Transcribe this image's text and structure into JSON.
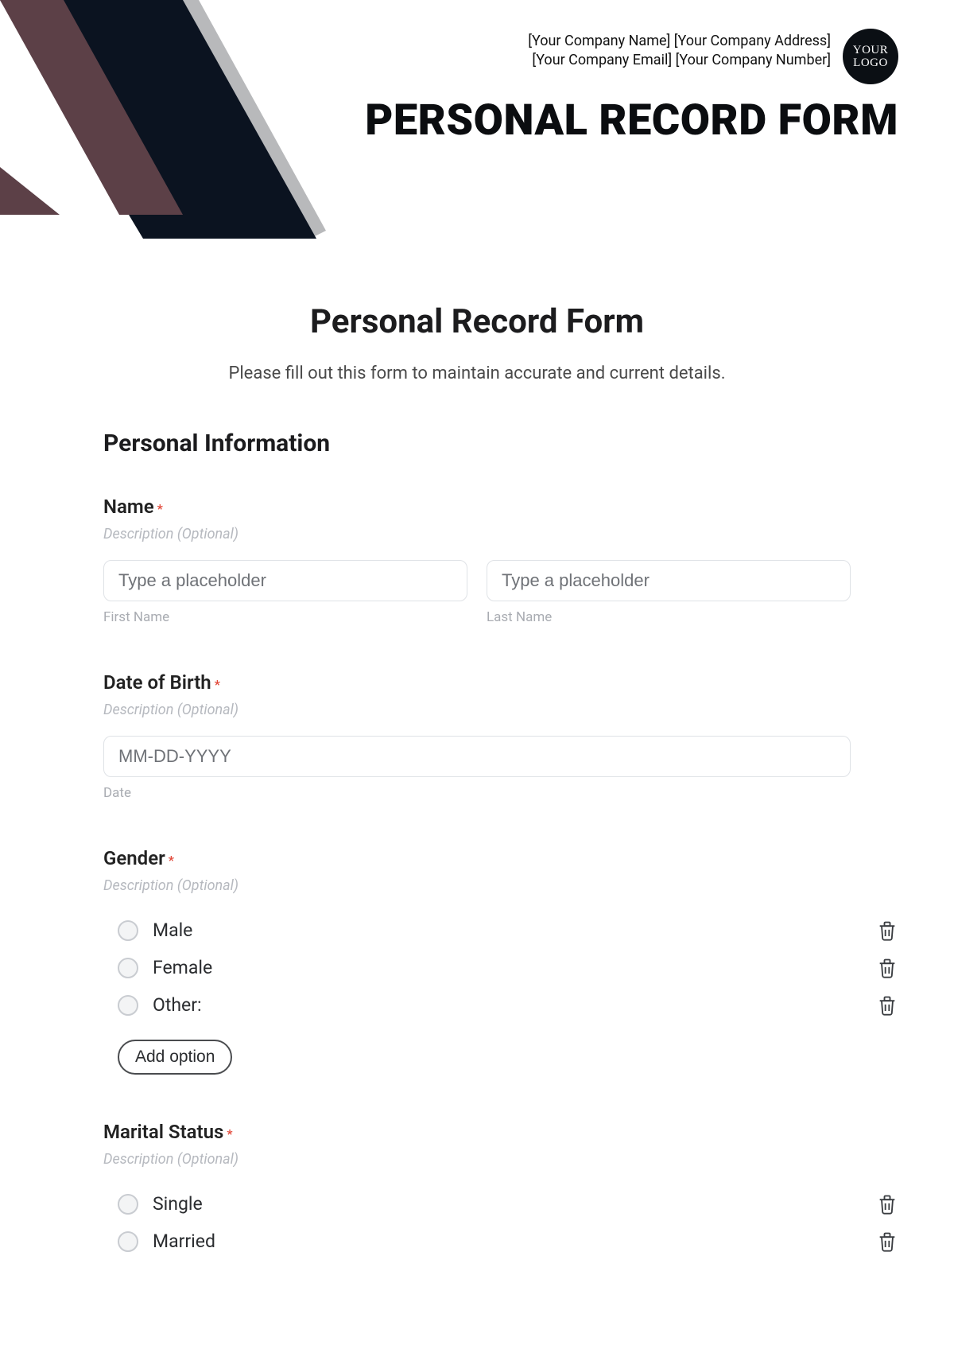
{
  "header": {
    "company_line1": "[Your Company Name] [Your Company Address]",
    "company_line2": "[Your Company Email] [Your Company Number]",
    "logo_text": "YOUR LOGO",
    "big_title": "PERSONAL RECORD FORM"
  },
  "form": {
    "title": "Personal Record Form",
    "subtitle": "Please fill out this form to maintain accurate and current details.",
    "section_heading": "Personal Information",
    "required_mark": "*",
    "description_placeholder": "Description (Optional)",
    "add_option_label": "Add option",
    "fields": {
      "name": {
        "label": "Name",
        "first_placeholder": "Type a placeholder",
        "first_sublabel": "First Name",
        "last_placeholder": "Type a placeholder",
        "last_sublabel": "Last Name"
      },
      "dob": {
        "label": "Date of Birth",
        "placeholder": "MM-DD-YYYY",
        "sublabel": "Date"
      },
      "gender": {
        "label": "Gender",
        "options": [
          "Male",
          "Female",
          "Other:"
        ]
      },
      "marital": {
        "label": "Marital Status",
        "options": [
          "Single",
          "Married"
        ]
      }
    }
  },
  "colors": {
    "dark": "#0b1320",
    "mauve": "#5c4047",
    "gray": "#b8b9bb"
  }
}
